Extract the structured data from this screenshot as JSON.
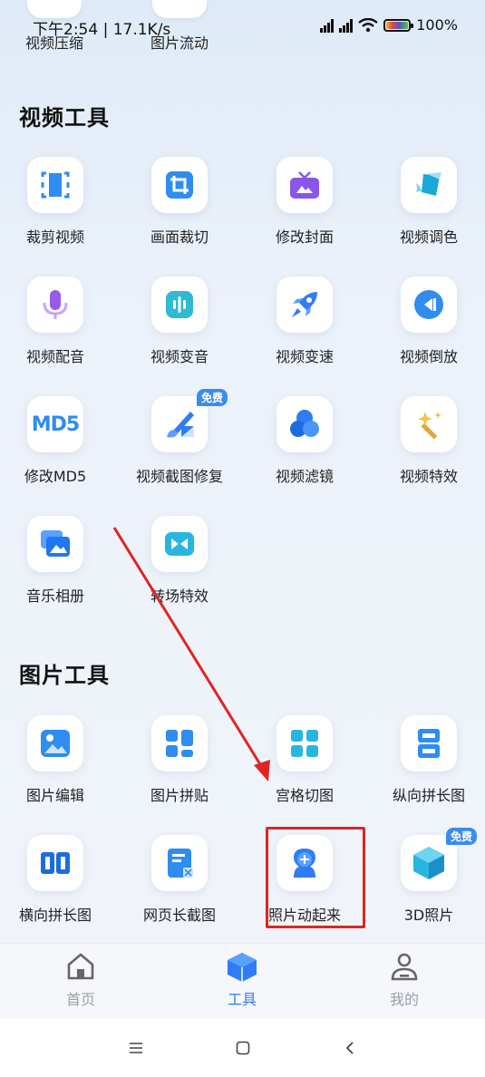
{
  "status": {
    "time": "下午2:54 | 17.1K/s",
    "battery": "100%"
  },
  "previous_row": [
    "视频压缩",
    "图片流动"
  ],
  "video_tools": {
    "title": "视频工具",
    "items": [
      {
        "label": "裁剪视频",
        "icon": "crop-video-icon"
      },
      {
        "label": "画面裁切",
        "icon": "frame-crop-icon"
      },
      {
        "label": "修改封面",
        "icon": "tv-cover-icon"
      },
      {
        "label": "视频调色",
        "icon": "paint-bucket-icon"
      },
      {
        "label": "视频配音",
        "icon": "microphone-icon"
      },
      {
        "label": "视频变音",
        "icon": "voice-change-icon"
      },
      {
        "label": "视频变速",
        "icon": "rocket-icon"
      },
      {
        "label": "视频倒放",
        "icon": "rewind-icon"
      },
      {
        "label": "修改MD5",
        "icon": "md5-icon"
      },
      {
        "label": "视频截图修复",
        "icon": "brush-icon",
        "badge": "免费"
      },
      {
        "label": "视频滤镜",
        "icon": "filter-circles-icon"
      },
      {
        "label": "视频特效",
        "icon": "magic-wand-icon"
      },
      {
        "label": "音乐相册",
        "icon": "music-album-icon"
      },
      {
        "label": "转场特效",
        "icon": "transition-icon"
      }
    ]
  },
  "image_tools": {
    "title": "图片工具",
    "items": [
      {
        "label": "图片编辑",
        "icon": "image-edit-icon"
      },
      {
        "label": "图片拼贴",
        "icon": "collage-icon"
      },
      {
        "label": "宫格切图",
        "icon": "grid-cut-icon"
      },
      {
        "label": "纵向拼长图",
        "icon": "vertical-stitch-icon"
      },
      {
        "label": "横向拼长图",
        "icon": "horizontal-stitch-icon"
      },
      {
        "label": "网页长截图",
        "icon": "webpage-screenshot-icon"
      },
      {
        "label": "照片动起来",
        "icon": "animate-photo-icon"
      },
      {
        "label": "3D照片",
        "icon": "cube-3d-icon",
        "badge": "免费"
      }
    ]
  },
  "tabs": [
    {
      "label": "首页",
      "icon": "home-icon",
      "active": false
    },
    {
      "label": "工具",
      "icon": "tools-cube-icon",
      "active": true
    },
    {
      "label": "我的",
      "icon": "profile-icon",
      "active": false
    }
  ],
  "colors": {
    "accent": "#2f7cf6",
    "inactive_tab": "#9aa0a8",
    "highlight": "#e02424"
  }
}
